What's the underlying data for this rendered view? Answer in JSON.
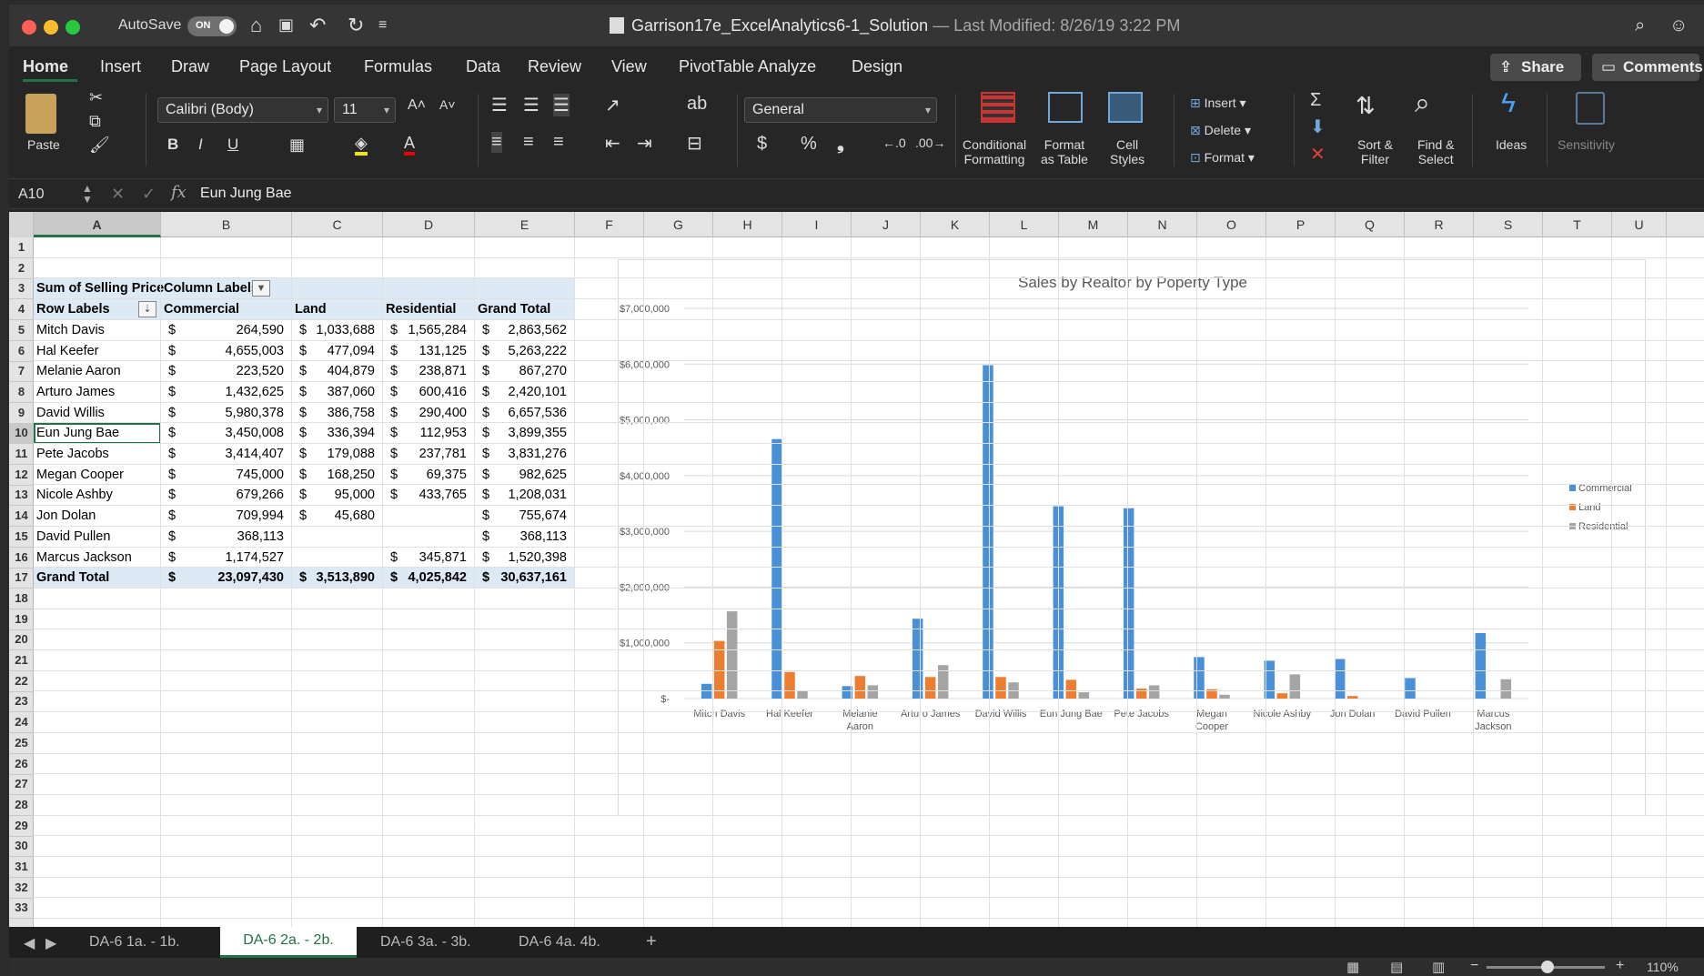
{
  "window": {
    "autosave_label": "AutoSave",
    "autosave_state": "ON",
    "file_name": "Garrison17e_ExcelAnalytics6-1_Solution",
    "modified": "— Last Modified: 8/26/19 3:22 PM"
  },
  "menu": [
    "Home",
    "Insert",
    "Draw",
    "Page Layout",
    "Formulas",
    "Data",
    "Review",
    "View",
    "PivotTable Analyze",
    "Design"
  ],
  "share_label": "Share",
  "comments_label": "Comments",
  "ribbon": {
    "paste": "Paste",
    "font_name": "Calibri (Body)",
    "font_size": "11",
    "number_format": "General",
    "conditional_1": "Conditional",
    "conditional_2": "Formatting",
    "format_table_1": "Format",
    "format_table_2": "as Table",
    "cell_styles_1": "Cell",
    "cell_styles_2": "Styles",
    "insert": "Insert",
    "delete": "Delete",
    "format": "Format",
    "sort_1": "Sort &",
    "sort_2": "Filter",
    "find_1": "Find &",
    "find_2": "Select",
    "ideas": "Ideas",
    "sensitivity": "Sensitivity"
  },
  "formula_bar": {
    "name_box": "A10",
    "fx": "fx",
    "value": "Eun Jung Bae"
  },
  "columns": [
    "A",
    "B",
    "C",
    "D",
    "E",
    "F",
    "G",
    "H",
    "I",
    "J",
    "K",
    "L",
    "M",
    "N",
    "O",
    "P",
    "Q",
    "R",
    "S",
    "T",
    "U"
  ],
  "pivot": {
    "header": {
      "a": "Sum of Selling Price",
      "b": "Column Labels"
    },
    "labels": {
      "a": "Row Labels",
      "b": "Commercial",
      "c": "Land",
      "d": "Residential",
      "e": "Grand Total"
    },
    "rows": [
      {
        "name": "Mitch Davis",
        "commercial": "264,590",
        "land": "1,033,688",
        "residential": "1,565,284",
        "total": "2,863,562"
      },
      {
        "name": "Hal Keefer",
        "commercial": "4,655,003",
        "land": "477,094",
        "residential": "131,125",
        "total": "5,263,222"
      },
      {
        "name": "Melanie Aaron",
        "commercial": "223,520",
        "land": "404,879",
        "residential": "238,871",
        "total": "867,270"
      },
      {
        "name": "Arturo James",
        "commercial": "1,432,625",
        "land": "387,060",
        "residential": "600,416",
        "total": "2,420,101"
      },
      {
        "name": "David Willis",
        "commercial": "5,980,378",
        "land": "386,758",
        "residential": "290,400",
        "total": "6,657,536"
      },
      {
        "name": "Eun Jung Bae",
        "commercial": "3,450,008",
        "land": "336,394",
        "residential": "112,953",
        "total": "3,899,355"
      },
      {
        "name": "Pete Jacobs",
        "commercial": "3,414,407",
        "land": "179,088",
        "residential": "237,781",
        "total": "3,831,276"
      },
      {
        "name": "Megan Cooper",
        "commercial": "745,000",
        "land": "168,250",
        "residential": "69,375",
        "total": "982,625"
      },
      {
        "name": "Nicole Ashby",
        "commercial": "679,266",
        "land": "95,000",
        "residential": "433,765",
        "total": "1,208,031"
      },
      {
        "name": "Jon Dolan",
        "commercial": "709,994",
        "land": "45,680",
        "residential": "",
        "total": "755,674"
      },
      {
        "name": "David Pullen",
        "commercial": "368,113",
        "land": "",
        "residential": "",
        "total": "368,113"
      },
      {
        "name": "Marcus Jackson",
        "commercial": "1,174,527",
        "land": "",
        "residential": "345,871",
        "total": "1,520,398"
      }
    ],
    "grand": {
      "name": "Grand Total",
      "commercial": "23,097,430",
      "land": "3,513,890",
      "residential": "4,025,842",
      "total": "30,637,161"
    }
  },
  "chart_data": {
    "type": "bar",
    "title": "Sales by Realtor by Poperty Type",
    "categories": [
      "Mitch Davis",
      "Hal Keefer",
      "Melanie Aaron",
      "Arturo James",
      "David Willis",
      "Eun Jung Bae",
      "Pete Jacobs",
      "Megan Cooper",
      "Nicole Ashby",
      "Jon Dolan",
      "David Pullen",
      "Marcus Jackson"
    ],
    "category_lines": [
      [
        "Mitch Davis"
      ],
      [
        "Hal Keefer"
      ],
      [
        "Melanie",
        "Aaron"
      ],
      [
        "Arturo James"
      ],
      [
        "David Willis"
      ],
      [
        "Eun Jung Bae"
      ],
      [
        "Pete Jacobs"
      ],
      [
        "Megan",
        "Cooper"
      ],
      [
        "Nicole Ashby"
      ],
      [
        "Jon Dolan"
      ],
      [
        "David Pullen"
      ],
      [
        "Marcus",
        "Jackson"
      ]
    ],
    "series": [
      {
        "name": "Commercial",
        "color": "#4a90d9",
        "values": [
          264590,
          4655003,
          223520,
          1432625,
          5980378,
          3450008,
          3414407,
          745000,
          679266,
          709994,
          368113,
          1174527
        ]
      },
      {
        "name": "Land",
        "color": "#ed7d31",
        "values": [
          1033688,
          477094,
          404879,
          387060,
          386758,
          336394,
          179088,
          168250,
          95000,
          45680,
          0,
          0
        ]
      },
      {
        "name": "Residential",
        "color": "#a5a5a5",
        "values": [
          1565284,
          131125,
          238871,
          600416,
          290400,
          112953,
          237781,
          69375,
          433765,
          0,
          0,
          345871
        ]
      }
    ],
    "yticks": [
      "$-",
      "$1,000,000",
      "$2,000,000",
      "$3,000,000",
      "$4,000,000",
      "$5,000,000",
      "$6,000,000",
      "$7,000,000"
    ],
    "ylim": [
      0,
      7000000
    ],
    "legend_position": "right",
    "grid": true
  },
  "sheet_tabs": [
    "DA-6 1a. - 1b.",
    "DA-6 2a. - 2b.",
    "DA-6 3a. - 3b.",
    "DA-6 4a. 4b."
  ],
  "active_tab": "DA-6 2a. - 2b.",
  "zoom": "110%"
}
